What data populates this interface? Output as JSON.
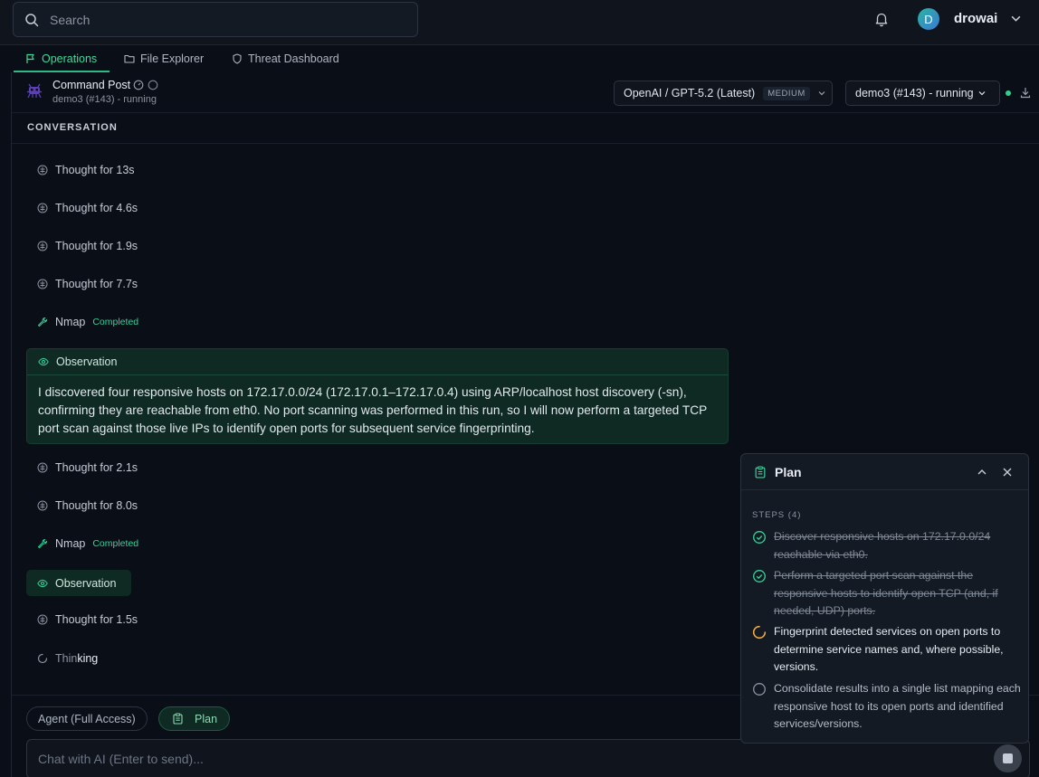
{
  "search": {
    "placeholder": "Search"
  },
  "user": {
    "initial": "D",
    "name": "drowai"
  },
  "tabs": [
    {
      "label": "Operations",
      "icon": "flag-icon",
      "active": true
    },
    {
      "label": "File Explorer",
      "icon": "folder-icon",
      "active": false
    },
    {
      "label": "Threat Dashboard",
      "icon": "shield-icon",
      "active": false
    }
  ],
  "command_post": {
    "title": "Command Post",
    "subtitle": "demo3 (#143) - running"
  },
  "model": {
    "label": "OpenAI / GPT-5.2 (Latest)",
    "effort": "MEDIUM"
  },
  "run": {
    "label": "demo3 (#143) - running",
    "status_color": "#2fd08a"
  },
  "conversation": {
    "header": "CONVERSATION",
    "items": [
      {
        "type": "thought",
        "label": "Thought for 13s"
      },
      {
        "type": "thought",
        "label": "Thought for 4.6s"
      },
      {
        "type": "thought",
        "label": "Thought for 1.9s"
      },
      {
        "type": "thought",
        "label": "Thought for 7.7s"
      },
      {
        "type": "tool",
        "label": "Nmap",
        "status": "Completed"
      },
      {
        "type": "observation",
        "label": "Observation",
        "text": "I discovered four responsive hosts on 172.17.0.0/24 (172.17.0.1–172.17.0.4) using ARP/localhost host discovery (-sn), confirming they are reachable from eth0. No port scanning was performed in this run, so I will now perform a targeted TCP port scan against those live IPs to identify open ports for subsequent service fingerprinting."
      },
      {
        "type": "thought",
        "label": "Thought for 2.1s"
      },
      {
        "type": "thought",
        "label": "Thought for 8.0s"
      },
      {
        "type": "tool",
        "label": "Nmap",
        "status": "Completed"
      },
      {
        "type": "observation_collapsed",
        "label": "Observation"
      },
      {
        "type": "thought",
        "label": "Thought for 1.5s"
      },
      {
        "type": "thinking",
        "label_dim": "Thin",
        "label_bright": "king"
      }
    ]
  },
  "composer": {
    "mode_label": "Agent (Full Access)",
    "plan_label": "Plan",
    "placeholder": "Chat with AI (Enter to send)..."
  },
  "plan": {
    "title": "Plan",
    "steps_label": "STEPS (4)",
    "steps": [
      {
        "status": "done",
        "text": "Discover responsive hosts on 172.17.0.0/24 reachable via eth0."
      },
      {
        "status": "done",
        "text": "Perform a targeted port scan against the responsive hosts to identify open TCP (and, if needed, UDP) ports."
      },
      {
        "status": "in-progress",
        "text": "Fingerprint detected services on open ports to determine service names and, where possible, versions."
      },
      {
        "status": "pending",
        "text": "Consolidate results into a single list mapping each responsive host to its open ports and identified services/versions."
      }
    ]
  },
  "colors": {
    "accent": "#2fb987",
    "background": "#0a0e17",
    "panel": "#131a24",
    "observation_bg": "#0f2a22",
    "spinner": "#f0a93a"
  }
}
